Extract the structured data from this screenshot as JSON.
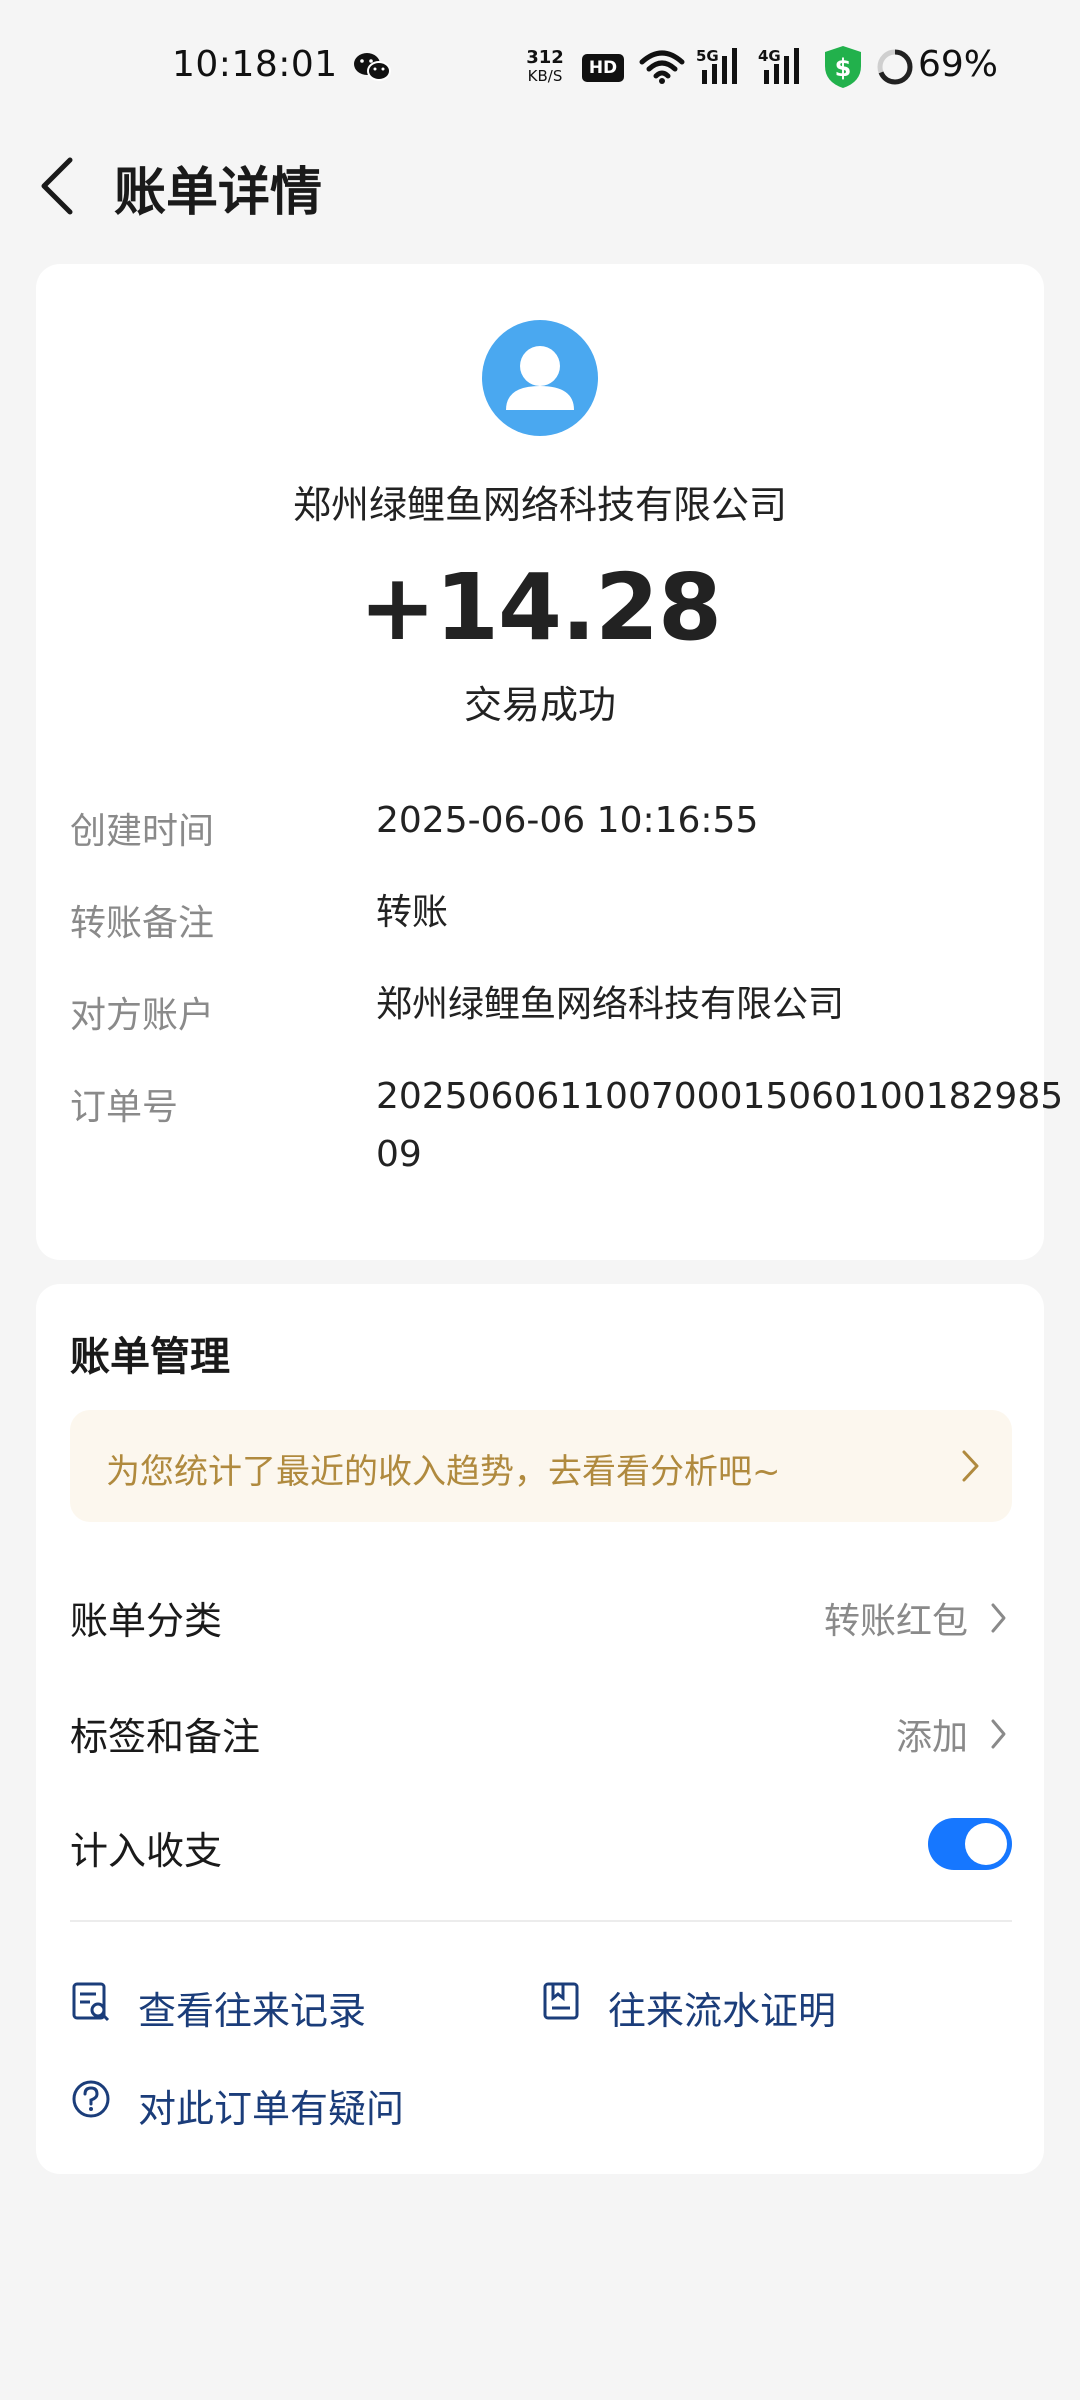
{
  "status_bar": {
    "time": "10:18:01",
    "net_speed_value": "312",
    "net_speed_unit": "KB/S",
    "hd_label": "HD",
    "signal_5g_label": "5G",
    "signal_4g_label": "4G",
    "battery_percent": "69%",
    "battery_level": 0.69,
    "icons": [
      "wechat-icon",
      "wifi-icon",
      "signal-icon",
      "shield-dollar-icon",
      "battery-ring-icon"
    ]
  },
  "header": {
    "title": "账单详情"
  },
  "transaction": {
    "payee": "郑州绿鲤鱼网络科技有限公司",
    "amount": "+14.28",
    "status": "交易成功",
    "details": [
      {
        "label": "创建时间",
        "value": "2025-06-06 10:16:55"
      },
      {
        "label": "转账备注",
        "value": "转账"
      },
      {
        "label": "对方账户",
        "value": "郑州绿鲤鱼网络科技有限公司"
      },
      {
        "label": "订单号",
        "value": "20250606110070001506010018298509"
      }
    ]
  },
  "manage": {
    "title": "账单管理",
    "insight_banner": "为您统计了最近的收入趋势，去看看分析吧~",
    "category_label": "账单分类",
    "category_value": "转账红包",
    "tags_label": "标签和备注",
    "tags_value": "添加",
    "toggle_label": "计入收支",
    "toggle_on": true,
    "links": {
      "history": "查看往来记录",
      "proof": "往来流水证明",
      "question": "对此订单有疑问"
    }
  },
  "colors": {
    "accent": "#1677ff",
    "avatar": "#4aa8f0",
    "banner_text": "#b08a3e",
    "link_text": "#1b3d7a",
    "shield": "#22b14c"
  }
}
